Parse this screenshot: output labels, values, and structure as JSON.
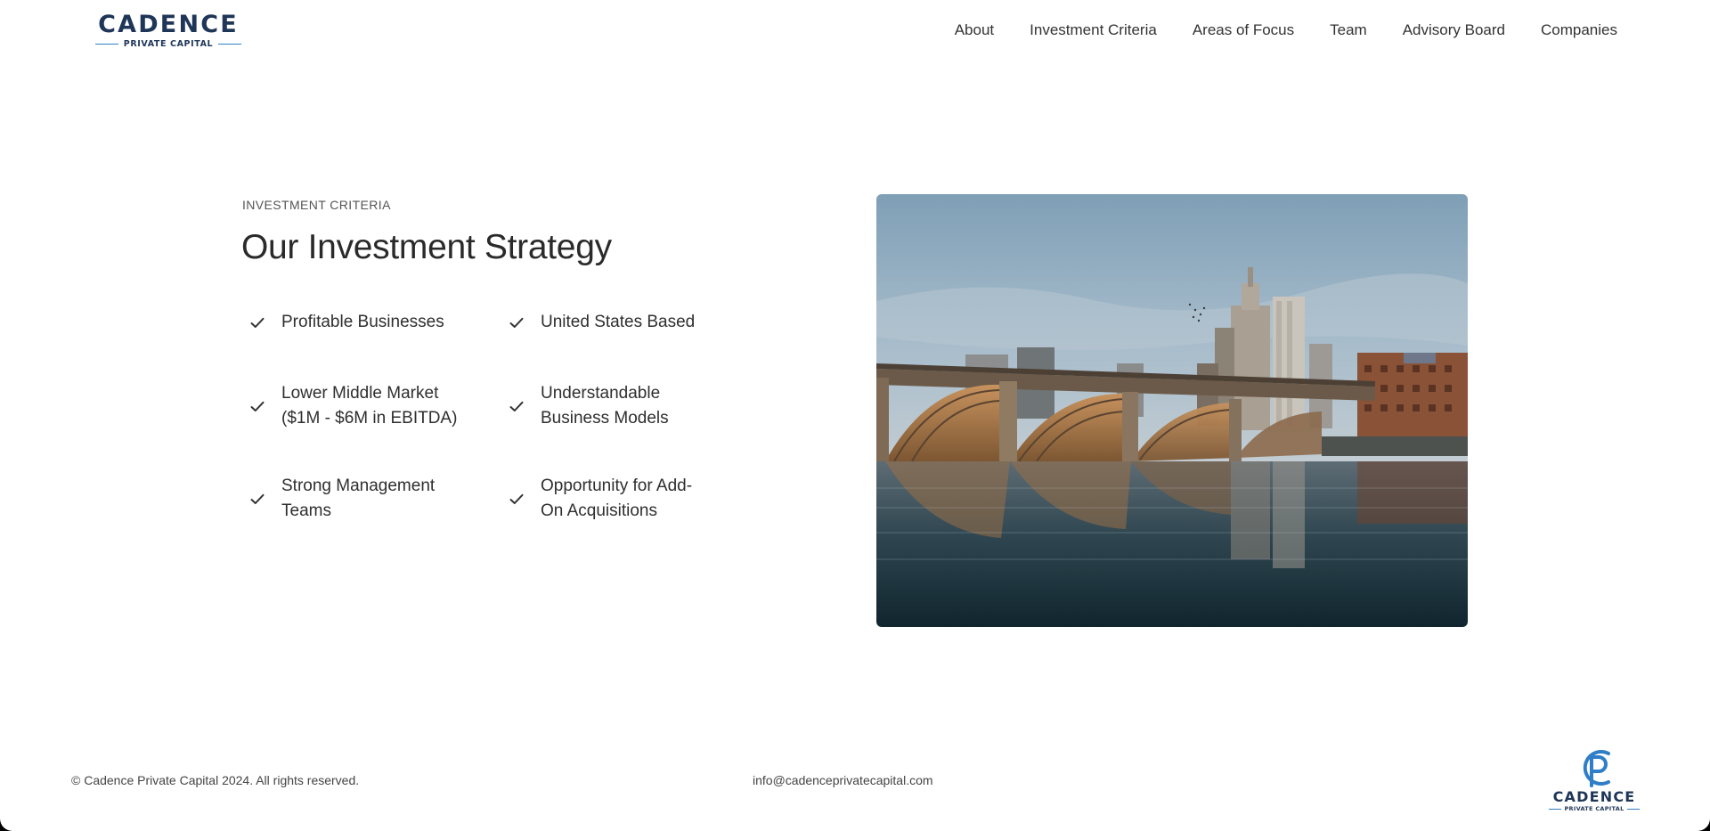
{
  "brand": {
    "name": "CADENCE",
    "tagline": "PRIVATE CAPITAL",
    "navy": "#1f3658",
    "accent": "#2f7ec7"
  },
  "nav": {
    "items": [
      {
        "label": "About"
      },
      {
        "label": "Investment Criteria"
      },
      {
        "label": "Areas of Focus"
      },
      {
        "label": "Team"
      },
      {
        "label": "Advisory Board"
      },
      {
        "label": "Companies"
      }
    ]
  },
  "section": {
    "eyebrow": "INVESTMENT CRITERIA",
    "title": "Our Investment Strategy",
    "criteria": [
      {
        "line1": "Profitable Businesses",
        "line2": ""
      },
      {
        "line1": "United States Based",
        "line2": ""
      },
      {
        "line1": "Lower Middle Market",
        "line2": "($1M - $6M in EBITDA)"
      },
      {
        "line1": "Understandable",
        "line2": "Business Models"
      },
      {
        "line1": "Strong Management",
        "line2": "Teams"
      },
      {
        "line1": "Opportunity for Add-",
        "line2": "On Acquisitions"
      }
    ],
    "check_icon": "check-icon"
  },
  "footer": {
    "copyright": "© Cadence Private Capital 2024. All rights reserved.",
    "email": "info@cadenceprivatecapital.com",
    "logo_word": "CADENCE",
    "logo_tagline": "PRIVATE CAPITAL"
  }
}
